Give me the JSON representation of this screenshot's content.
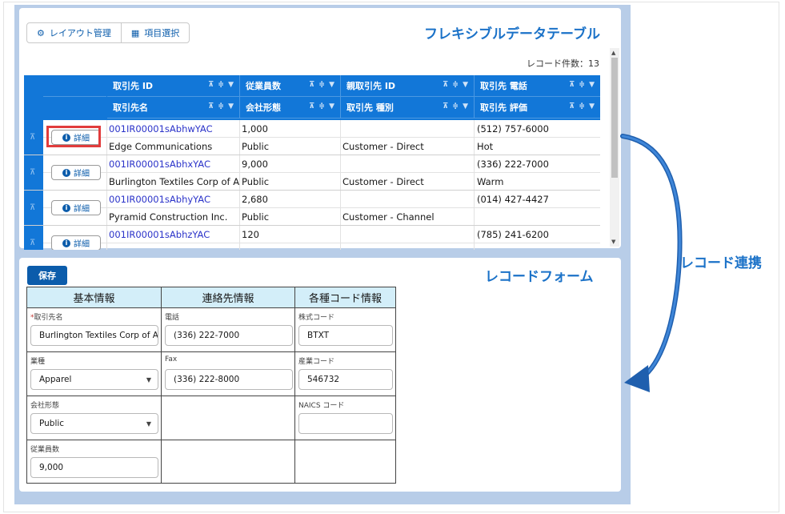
{
  "toolbar": {
    "layout_label": "レイアウト管理",
    "column_select_label": "項目選択"
  },
  "titles": {
    "table_title": "フレキシブルデータテーブル",
    "form_title": "レコードフォーム",
    "link_label": "レコード連携"
  },
  "record_count": "レコード件数：13",
  "table": {
    "headers_row1": [
      "取引先 ID",
      "従業員数",
      "親取引先 ID",
      "取引先 電話"
    ],
    "headers_row2": [
      "取引先名",
      "会社形態",
      "取引先 種別",
      "取引先 評価"
    ],
    "detail_label": "詳細",
    "rows": [
      {
        "id": "001IR00001sAbhwYAC",
        "employees": "1,000",
        "parent": "",
        "phone": "(512) 757-6000",
        "name": "Edge Communications",
        "ownership": "Public",
        "type": "Customer - Direct",
        "rating": "Hot"
      },
      {
        "id": "001IR00001sAbhxYAC",
        "employees": "9,000",
        "parent": "",
        "phone": "(336) 222-7000",
        "name": "Burlington Textiles Corp of A",
        "ownership": "Public",
        "type": "Customer - Direct",
        "rating": "Warm"
      },
      {
        "id": "001IR00001sAbhyYAC",
        "employees": "2,680",
        "parent": "",
        "phone": "(014) 427-4427",
        "name": "Pyramid Construction Inc.",
        "ownership": "Public",
        "type": "Customer - Channel",
        "rating": ""
      },
      {
        "id": "001IR00001sAbhzYAC",
        "employees": "120",
        "parent": "",
        "phone": "(785) 241-6200",
        "name": "",
        "ownership": "",
        "type": "",
        "rating": ""
      }
    ]
  },
  "form": {
    "save_label": "保存",
    "col_headers": [
      "基本情報",
      "連絡先情報",
      "各種コード情報"
    ],
    "fields": {
      "account_name": {
        "label": "取引先名",
        "value": "Burlington Textiles Corp of A"
      },
      "industry": {
        "label": "業種",
        "value": "Apparel"
      },
      "ownership": {
        "label": "会社形態",
        "value": "Public"
      },
      "employees": {
        "label": "従業員数",
        "value": "9,000"
      },
      "phone": {
        "label": "電話",
        "value": "(336) 222-7000"
      },
      "fax": {
        "label": "Fax",
        "value": "(336) 222-8000"
      },
      "ticker": {
        "label": "株式コード",
        "value": "BTXT"
      },
      "sic": {
        "label": "産業コード",
        "value": "546732"
      },
      "naics": {
        "label": "NAICS コード",
        "value": ""
      }
    }
  },
  "colors": {
    "header_blue": "#1277d8",
    "accent_blue": "#1b72c8",
    "highlight_red": "#e13c3c",
    "form_header_bg": "#d3eef9"
  }
}
